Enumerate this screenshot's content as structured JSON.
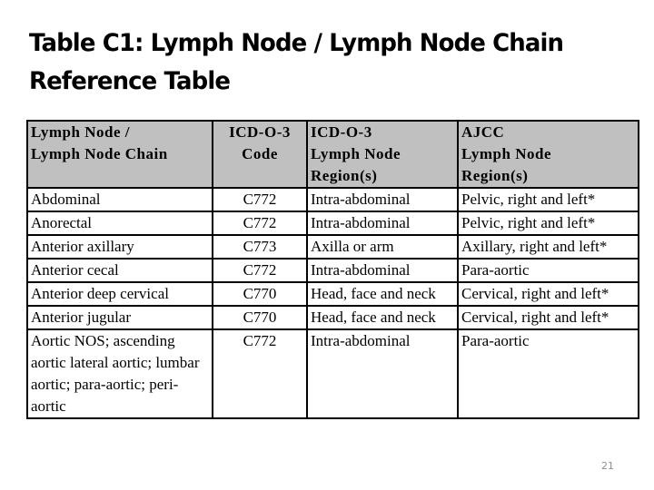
{
  "title": "Table C1: Lymph Node / Lymph Node Chain Reference Table",
  "table": {
    "headers": [
      "Lymph Node / Lymph Node Chain",
      "ICD-O-3 Code",
      "ICD-O-3 Lymph Node Region(s)",
      "AJCC Lymph Node Region(s)"
    ],
    "header_lines": [
      [
        "Lymph Node /",
        "Lymph Node Chain"
      ],
      [
        "ICD-O-3",
        "Code"
      ],
      [
        "ICD-O-3",
        "Lymph Node",
        "Region(s)"
      ],
      [
        "AJCC",
        "Lymph Node",
        "Region(s)"
      ]
    ],
    "rows": [
      [
        "Abdominal",
        "C772",
        "Intra-abdominal",
        "Pelvic, right and left*"
      ],
      [
        "Anorectal",
        "C772",
        "Intra-abdominal",
        "Pelvic, right and left*"
      ],
      [
        "Anterior axillary",
        "C773",
        "Axilla or arm",
        "Axillary, right and left*"
      ],
      [
        "Anterior cecal",
        "C772",
        "Intra-abdominal",
        "Para-aortic"
      ],
      [
        "Anterior deep cervical",
        "C770",
        "Head, face and neck",
        "Cervical, right and left*"
      ],
      [
        "Anterior jugular",
        "C770",
        "Head, face and neck",
        "Cervical, right and left*"
      ],
      [
        "Aortic NOS; ascending aortic lateral aortic; lumbar aortic; para-aortic; peri-aortic",
        "C772",
        "Intra-abdominal",
        "Para-aortic"
      ]
    ],
    "header_bg": "#c0c0c0"
  },
  "page_number": "21"
}
